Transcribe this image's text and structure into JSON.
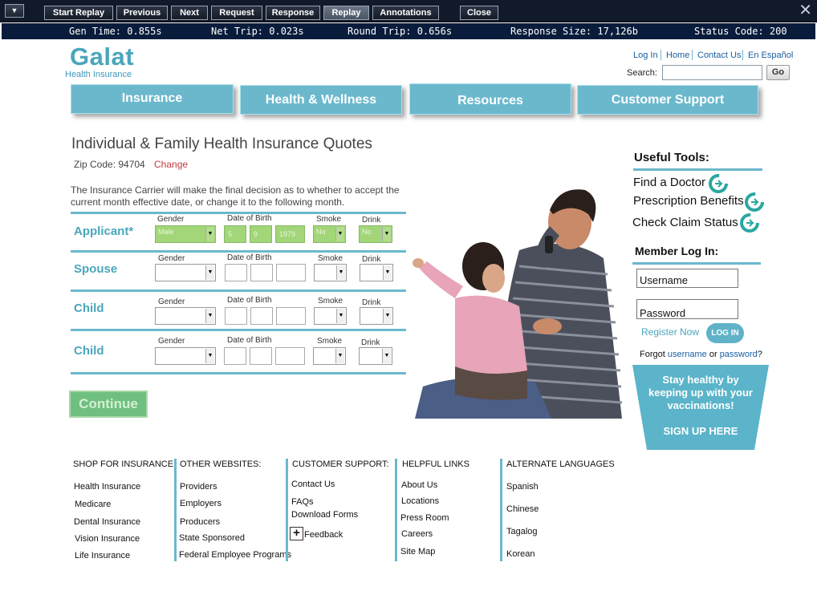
{
  "toolbar": {
    "buttons": [
      "Start Replay",
      "Previous",
      "Next",
      "Request",
      "Response",
      "Replay",
      "Annotations",
      "Close"
    ],
    "active_button": "Replay"
  },
  "stats": {
    "gen_time": "Gen Time: 0.855s",
    "net_trip": "Net Trip: 0.023s",
    "round_trip": "Round Trip: 0.656s",
    "response_size": "Response Size: 17,126b",
    "status_code": "Status Code: 200"
  },
  "header": {
    "logo": "Galat",
    "logo_sub": "Health Insurance",
    "links": [
      "Log In",
      "Home",
      "Contact Us",
      "En Español"
    ],
    "search_label": "Search:",
    "search_value": "",
    "go_label": "Go"
  },
  "nav": [
    "Insurance",
    "Health & Wellness",
    "Resources",
    "Customer Support"
  ],
  "quote": {
    "title": "Individual & Family Health Insurance Quotes",
    "zip_label": "Zip Code: 94704",
    "zip_change": "Change",
    "disclaimer": "The Insurance Carrier will make the final decision as to whether to accept the current month effective date, or change it to the following month.",
    "columns": {
      "gender": "Gender",
      "dob": "Date of Birth",
      "smoke": "Smoke",
      "drink": "Drink"
    },
    "applicant": {
      "label": "Applicant*",
      "gender": "Male",
      "month": "5",
      "day": "9",
      "year": "1979",
      "smoke": "No",
      "drink": "No"
    },
    "spouse_label": "Spouse",
    "child1_label": "Child",
    "child2_label": "Child",
    "continue": "Continue"
  },
  "sidebar": {
    "tools_heading": "Useful Tools:",
    "tools": [
      "Find a Doctor",
      "Prescription Benefits",
      "Check Claim Status"
    ],
    "member_heading": "Member Log In:",
    "username_placeholder": "Username",
    "password_placeholder": "Password",
    "register": "Register Now",
    "login": "LOG IN",
    "forgot_prefix": "Forgot ",
    "forgot_username": "username",
    "forgot_or": " or ",
    "forgot_password": "password",
    "forgot_suffix": "?",
    "promo_text": "Stay healthy by keeping up with your vaccinations!",
    "promo_cta": "SIGN UP HERE"
  },
  "footer": {
    "shop": {
      "heading": "SHOP FOR INSURANCE:",
      "items": [
        "Health Insurance",
        "Medicare",
        "Dental Insurance",
        "Vision Insurance",
        "Life Insurance"
      ]
    },
    "other": {
      "heading": "OTHER WEBSITES:",
      "items": [
        "Providers",
        "Employers",
        "Producers",
        "State Sponsored",
        "Federal Employee Programs"
      ]
    },
    "support": {
      "heading": "CUSTOMER SUPPORT:",
      "items": [
        "Contact Us",
        "FAQs",
        "Download Forms",
        "Feedback"
      ]
    },
    "helpful": {
      "heading": "HELPFUL LINKS",
      "items": [
        "About Us",
        "Locations",
        "Press Room",
        "Careers",
        "Site Map"
      ]
    },
    "languages": {
      "heading": "ALTERNATE LANGUAGES",
      "items": [
        "Spanish",
        "Chinese",
        "Tagalog",
        "Korean"
      ]
    }
  },
  "colors": {
    "accent": "#6bb8cd",
    "logo": "#4aa6bc",
    "toolbar": "#101a2a",
    "continue": "#6fc080"
  }
}
